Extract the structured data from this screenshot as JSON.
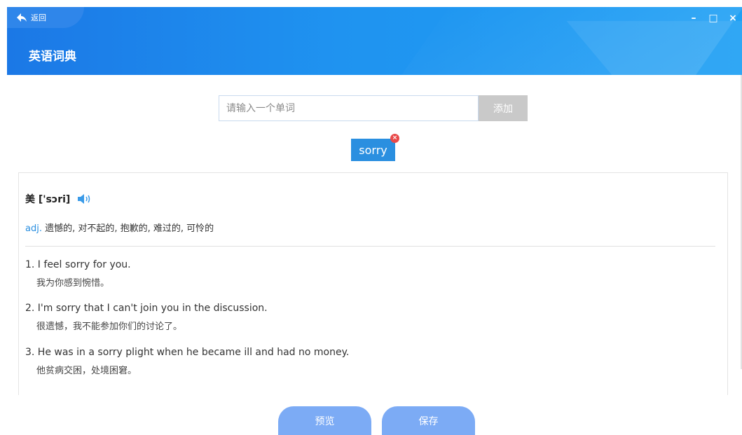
{
  "header": {
    "back_label": "返回",
    "title": "英语词典",
    "window_controls": {
      "minimize": "–",
      "maximize": "□",
      "close": "×"
    }
  },
  "search": {
    "placeholder": "请输入一个单词",
    "value": "",
    "add_label": "添加"
  },
  "tag": {
    "word": "sorry",
    "close_symbol": "×"
  },
  "entry": {
    "phonetic_region": "美",
    "phonetic": "['sɔri]",
    "pos": "adj.",
    "definition": "遗憾的, 对不起的, 抱歉的, 难过的, 可怜的",
    "examples": [
      {
        "en": "1. I feel sorry for you.",
        "zh": "我为你感到惋惜。"
      },
      {
        "en": "2. I'm sorry that I can't join you in the discussion.",
        "zh": "很遗憾，我不能参加你们的讨论了。"
      },
      {
        "en": "3. He was in a sorry plight when he became ill and had no money.",
        "zh": "他贫病交困，处境困窘。"
      }
    ]
  },
  "footer": {
    "preview_label": "预览",
    "save_label": "保存"
  }
}
